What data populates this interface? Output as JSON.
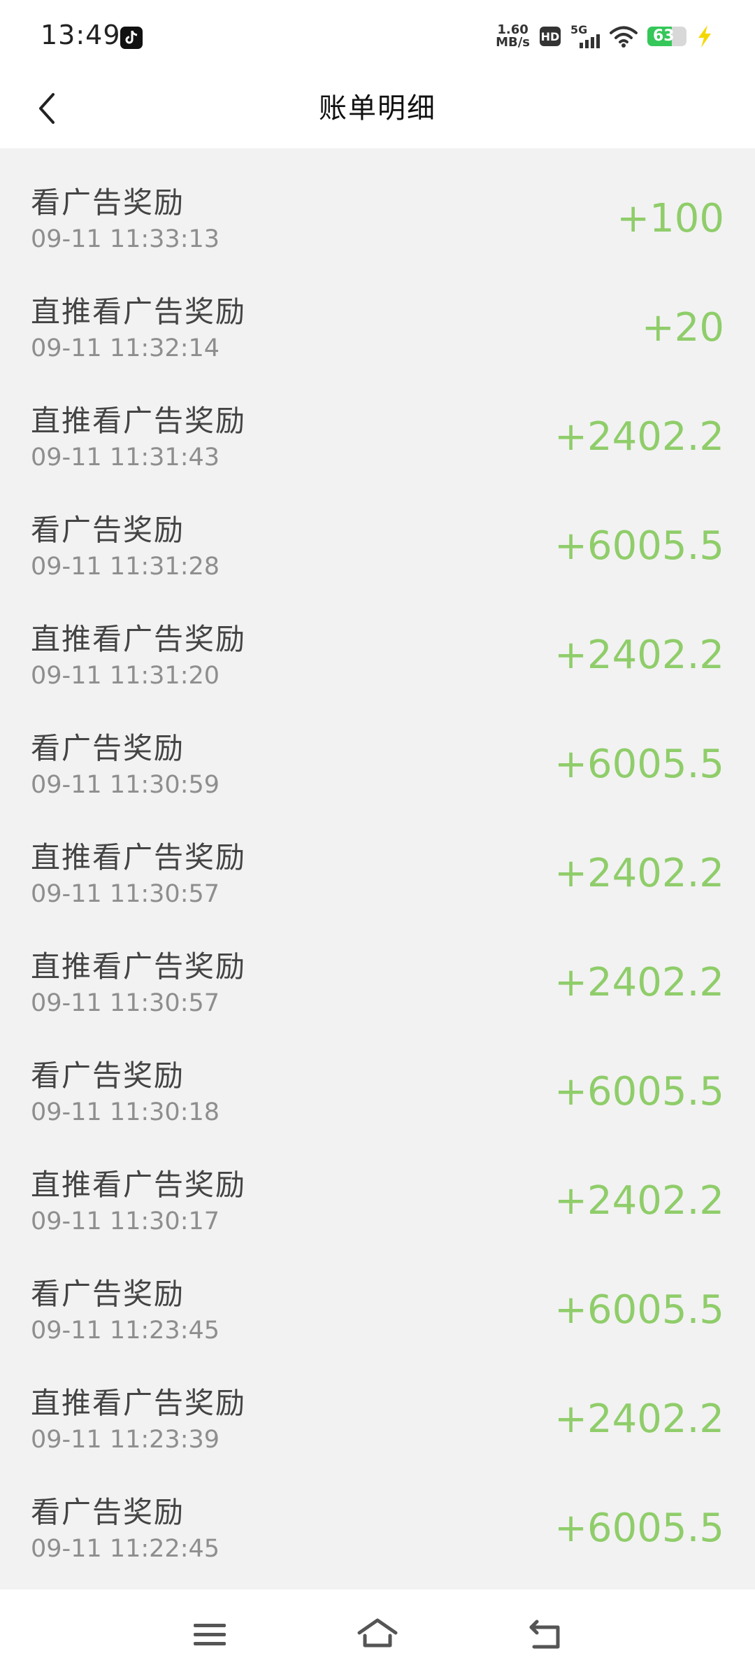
{
  "status_bar": {
    "time": "13:49",
    "net_speed_value": "1.60",
    "net_speed_unit": "MB/s",
    "hd_label": "HD",
    "network_label": "5G",
    "battery_level": "63",
    "battery_fraction": 0.63
  },
  "header": {
    "title": "账单明细"
  },
  "bills": [
    {
      "title": "看广告奖励",
      "time": "09-11 11:33:13",
      "amount": "+100"
    },
    {
      "title": "直推看广告奖励",
      "time": "09-11 11:32:14",
      "amount": "+20"
    },
    {
      "title": "直推看广告奖励",
      "time": "09-11 11:31:43",
      "amount": "+2402.2"
    },
    {
      "title": "看广告奖励",
      "time": "09-11 11:31:28",
      "amount": "+6005.5"
    },
    {
      "title": "直推看广告奖励",
      "time": "09-11 11:31:20",
      "amount": "+2402.2"
    },
    {
      "title": "看广告奖励",
      "time": "09-11 11:30:59",
      "amount": "+6005.5"
    },
    {
      "title": "直推看广告奖励",
      "time": "09-11 11:30:57",
      "amount": "+2402.2"
    },
    {
      "title": "直推看广告奖励",
      "time": "09-11 11:30:57",
      "amount": "+2402.2"
    },
    {
      "title": "看广告奖励",
      "time": "09-11 11:30:18",
      "amount": "+6005.5"
    },
    {
      "title": "直推看广告奖励",
      "time": "09-11 11:30:17",
      "amount": "+2402.2"
    },
    {
      "title": "看广告奖励",
      "time": "09-11 11:23:45",
      "amount": "+6005.5"
    },
    {
      "title": "直推看广告奖励",
      "time": "09-11 11:23:39",
      "amount": "+2402.2"
    },
    {
      "title": "看广告奖励",
      "time": "09-11 11:22:45",
      "amount": "+6005.5"
    }
  ],
  "icons": {
    "app": "tiktok-icon",
    "back": "chevron-left-icon",
    "nav_menu": "menu-icon",
    "nav_home": "home-icon",
    "nav_back": "back-arrow-icon"
  },
  "colors": {
    "amount": "#8fcd6a",
    "battery": "#35c759",
    "charging": "#f5d800",
    "background": "#f2f2f2"
  }
}
